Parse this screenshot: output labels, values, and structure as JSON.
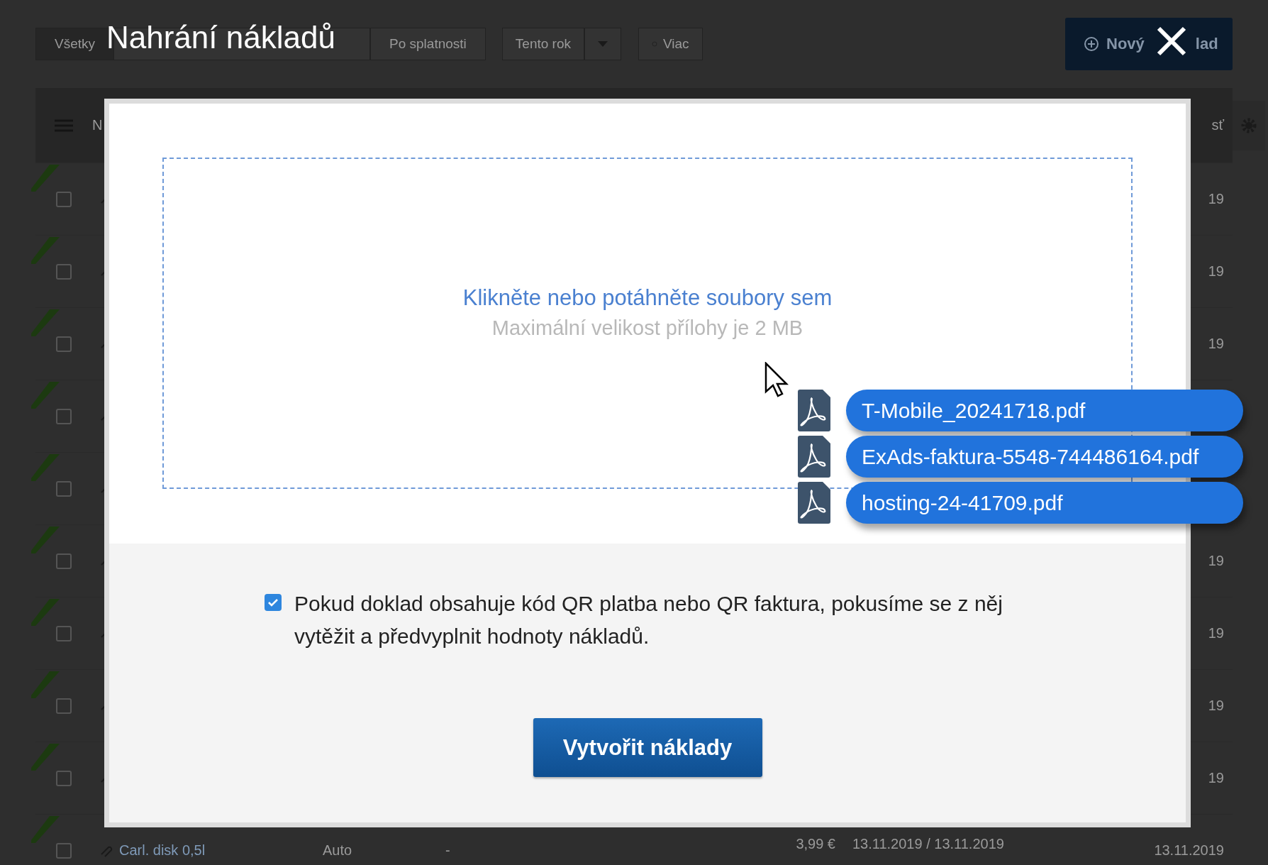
{
  "page": {
    "filters": [
      {
        "label": "Všetky",
        "selected": true
      },
      {
        "label": "Po splatnosti",
        "selected": false
      }
    ],
    "period": {
      "label": "Tento rok"
    },
    "more_button": {
      "label": "Viac"
    },
    "new_button": {
      "label_start": "Nový",
      "label_end": "lad"
    },
    "table": {
      "header": {
        "column_1": "N",
        "column_last": "sť"
      },
      "rows": [
        {
          "checked": false,
          "column_last": "19"
        },
        {
          "checked": false,
          "column_last": "19"
        },
        {
          "checked": false,
          "column_last": "19"
        },
        {
          "checked": false
        },
        {
          "checked": false
        },
        {
          "checked": false,
          "column_last": "19"
        },
        {
          "checked": false,
          "column_last": "19"
        },
        {
          "checked": false,
          "column_last": "19"
        },
        {
          "checked": false,
          "column_last": "19"
        }
      ],
      "last_row": {
        "checked": false,
        "name": "Carl. disk 0,5l",
        "category": "Auto",
        "column_3": "-",
        "amount": "3,99 €",
        "dates": "13.11.2019 / 13.11.2019",
        "column_last": "13.11.2019"
      }
    }
  },
  "modal": {
    "title": "Nahrání nákladů",
    "dropzone": {
      "prompt": "Klikněte nebo potáhněte soubory sem",
      "hint": "Maximální velikost přílohy je 2 MB"
    },
    "qr_option": {
      "checked": true,
      "label": "Pokud doklad obsahuje kód QR platba nebo QR faktura, pokusíme se z něj vytěžit a předvyplnit hodnoty nákladů."
    },
    "submit_button": {
      "label": "Vytvořit náklady"
    }
  },
  "dragged_files": [
    {
      "name": "T-Mobile_20241718.pdf"
    },
    {
      "name": "ExAds-faktura-5548-744486164.pdf"
    },
    {
      "name": "hosting-24-41709.pdf"
    }
  ]
}
